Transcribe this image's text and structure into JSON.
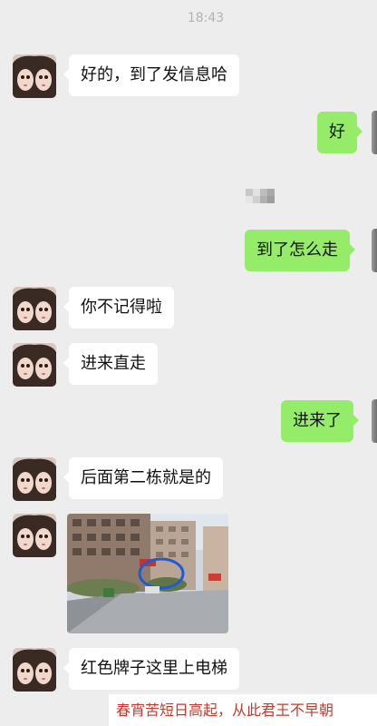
{
  "status": {
    "time": "18:43"
  },
  "messages": [
    {
      "side": "in",
      "text": "好的，到了发信息哈"
    },
    {
      "side": "out",
      "text": "好"
    },
    {
      "side": "out",
      "text": "到了怎么走"
    },
    {
      "side": "in",
      "text": "你不记得啦"
    },
    {
      "side": "in",
      "text": "进来直走"
    },
    {
      "side": "out",
      "text": "进来了"
    },
    {
      "side": "in",
      "text": "后面第二栋就是的"
    },
    {
      "side": "in",
      "type": "image",
      "description": "street-photo"
    },
    {
      "side": "in",
      "text": "红色牌子这里上电梯"
    }
  ],
  "watermark": {
    "text": "春宵苦短日高起，从此君王不早朝"
  },
  "colors": {
    "background": "#ededed",
    "incoming": "#ffffff",
    "outgoing": "#95ec69",
    "watermark": "#c23b2e"
  }
}
